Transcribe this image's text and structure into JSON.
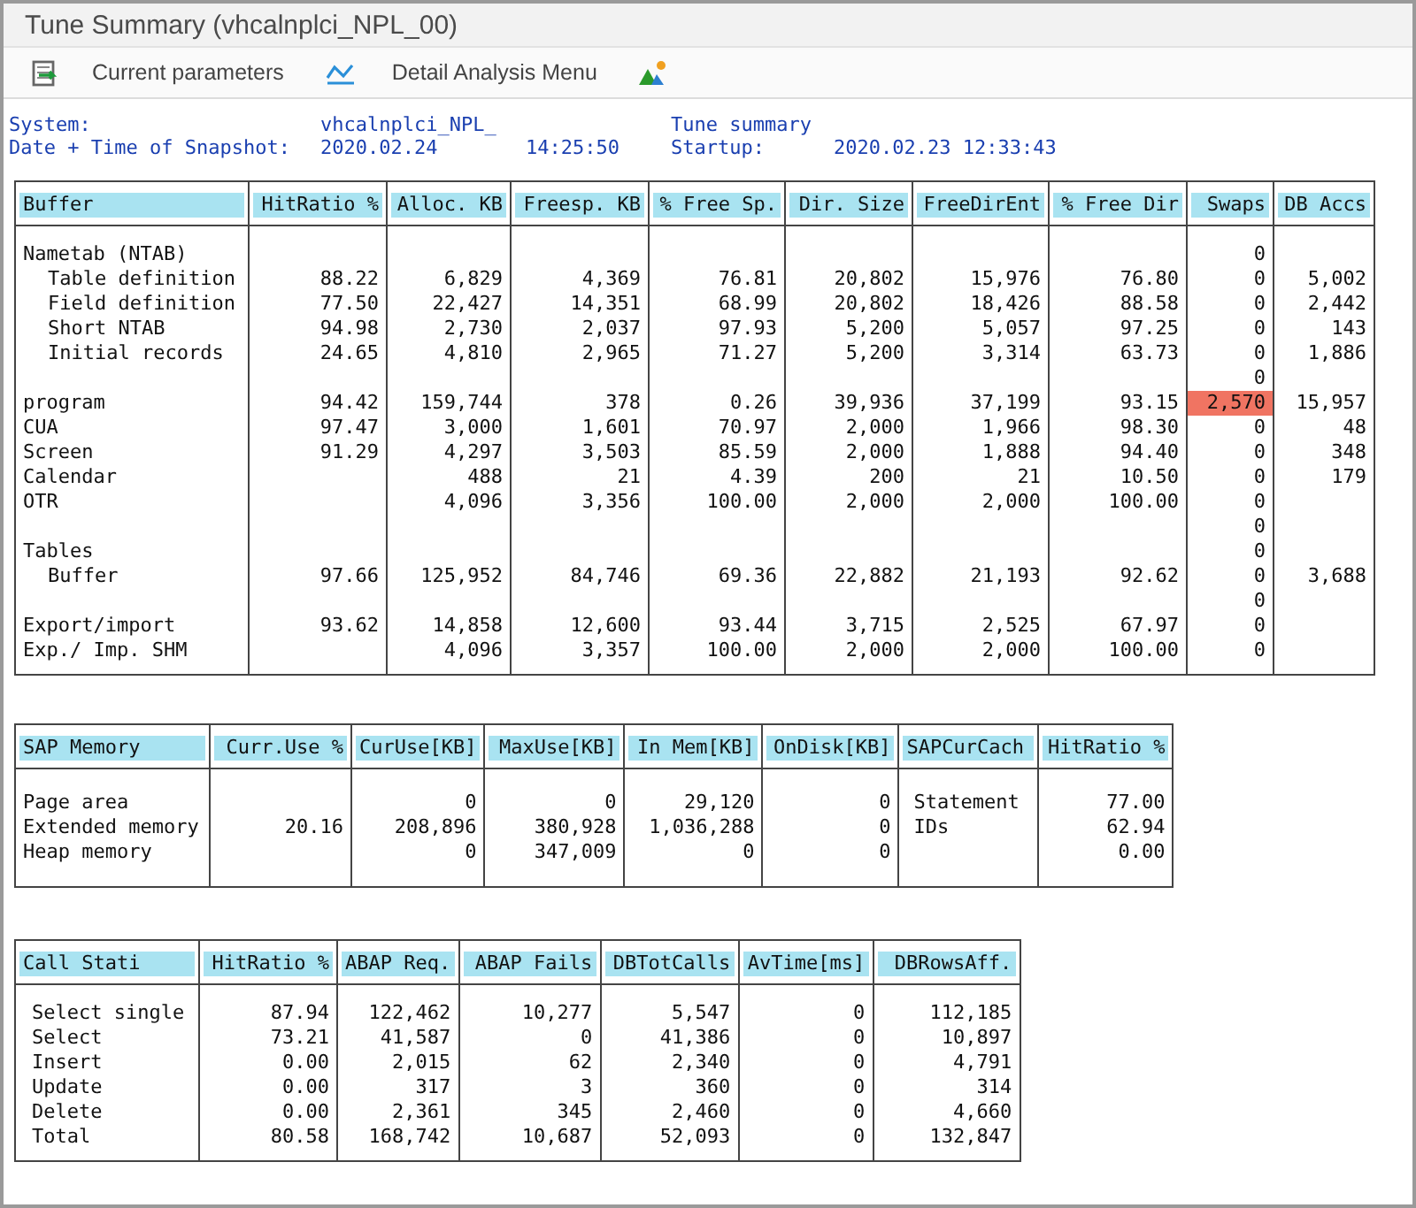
{
  "window": {
    "title": "Tune Summary (vhcalnplci_NPL_00)"
  },
  "toolbar": [
    {
      "kind": "sheet"
    },
    {
      "kind": "text",
      "label": "Current parameters"
    },
    {
      "kind": "chart"
    },
    {
      "kind": "text",
      "label": "Detail Analysis Menu"
    },
    {
      "kind": "mountain"
    }
  ],
  "info": {
    "system_label": "System:",
    "system": "vhcalnplci_NPL_",
    "report": "Tune summary",
    "snapshot_label": "Date + Time of Snapshot:",
    "snapshot_date": "2020.02.24",
    "snapshot_time": "14:25:50",
    "startup_label": "Startup:",
    "startup": "2020.02.23 12:33:43"
  },
  "buffer_table": {
    "columns": [
      {
        "label": "Buffer",
        "kind": "label"
      },
      {
        "label": "HitRatio %",
        "kind": "number"
      },
      {
        "label": "Alloc. KB",
        "kind": "number"
      },
      {
        "label": "Freesp. KB",
        "kind": "number"
      },
      {
        "label": "% Free Sp.",
        "kind": "number"
      },
      {
        "label": "Dir. Size",
        "kind": "number"
      },
      {
        "label": "FreeDirEnt",
        "kind": "number"
      },
      {
        "label": "% Free Dir",
        "kind": "number"
      },
      {
        "label": "Swaps",
        "kind": "counter"
      },
      {
        "label": "DB Accs",
        "kind": "number"
      }
    ],
    "rows": [
      {
        "label": "Nametab (NTAB)",
        "swaps": "0",
        "alert": false,
        "children": [
          {
            "label": "Table definition",
            "hit_ratio": "88.22",
            "alloc_kb": "6,829",
            "freesp_kb": "4,369",
            "free_sp_pct": "76.81",
            "dir_size": "20,802",
            "free_dir_ent": "15,976",
            "free_dir_pct": "76.80",
            "swaps": "0",
            "db_accs": "5,002",
            "alert": false
          },
          {
            "label": "Field definition",
            "hit_ratio": "77.50",
            "alloc_kb": "22,427",
            "freesp_kb": "14,351",
            "free_sp_pct": "68.99",
            "dir_size": "20,802",
            "free_dir_ent": "18,426",
            "free_dir_pct": "88.58",
            "swaps": "0",
            "db_accs": "2,442",
            "alert": false
          },
          {
            "label": "Short NTAB",
            "hit_ratio": "94.98",
            "alloc_kb": "2,730",
            "freesp_kb": "2,037",
            "free_sp_pct": "97.93",
            "dir_size": "5,200",
            "free_dir_ent": "5,057",
            "free_dir_pct": "97.25",
            "swaps": "0",
            "db_accs": "143",
            "alert": false
          },
          {
            "label": "Initial records",
            "hit_ratio": "24.65",
            "alloc_kb": "4,810",
            "freesp_kb": "2,965",
            "free_sp_pct": "71.27",
            "dir_size": "5,200",
            "free_dir_ent": "3,314",
            "free_dir_pct": "63.73",
            "swaps": "0",
            "db_accs": "1,886",
            "alert": false
          }
        ]
      },
      {
        "swaps": "0",
        "alert": false
      },
      {
        "label": "program",
        "hit_ratio": "94.42",
        "alloc_kb": "159,744",
        "freesp_kb": "378",
        "free_sp_pct": "0.26",
        "dir_size": "39,936",
        "free_dir_ent": "37,199",
        "free_dir_pct": "93.15",
        "swaps": "2,570",
        "db_accs": "15,957",
        "alert": true
      },
      {
        "label": "CUA",
        "hit_ratio": "97.47",
        "alloc_kb": "3,000",
        "freesp_kb": "1,601",
        "free_sp_pct": "70.97",
        "dir_size": "2,000",
        "free_dir_ent": "1,966",
        "free_dir_pct": "98.30",
        "swaps": "0",
        "db_accs": "48",
        "alert": false
      },
      {
        "label": "Screen",
        "hit_ratio": "91.29",
        "alloc_kb": "4,297",
        "freesp_kb": "3,503",
        "free_sp_pct": "85.59",
        "dir_size": "2,000",
        "free_dir_ent": "1,888",
        "free_dir_pct": "94.40",
        "swaps": "0",
        "db_accs": "348",
        "alert": false
      },
      {
        "label": "Calendar",
        "alloc_kb": "488",
        "freesp_kb": "21",
        "free_sp_pct": "4.39",
        "dir_size": "200",
        "free_dir_ent": "21",
        "free_dir_pct": "10.50",
        "swaps": "0",
        "db_accs": "179",
        "alert": false
      },
      {
        "label": "OTR",
        "alloc_kb": "4,096",
        "freesp_kb": "3,356",
        "free_sp_pct": "100.00",
        "dir_size": "2,000",
        "free_dir_ent": "2,000",
        "free_dir_pct": "100.00",
        "swaps": "0",
        "alert": false
      },
      {
        "swaps": "0",
        "alert": false
      },
      {
        "label": "Tables",
        "swaps": "0",
        "alert": false,
        "children": [
          {
            "label": "Buffer",
            "hit_ratio": "97.66",
            "alloc_kb": "125,952",
            "freesp_kb": "84,746",
            "free_sp_pct": "69.36",
            "dir_size": "22,882",
            "free_dir_ent": "21,193",
            "free_dir_pct": "92.62",
            "swaps": "0",
            "db_accs": "3,688",
            "alert": false
          }
        ]
      },
      {
        "swaps": "0",
        "alert": false
      },
      {
        "label": "Export/import",
        "hit_ratio": "93.62",
        "alloc_kb": "14,858",
        "freesp_kb": "12,600",
        "free_sp_pct": "93.44",
        "dir_size": "3,715",
        "free_dir_ent": "2,525",
        "free_dir_pct": "67.97",
        "swaps": "0",
        "alert": false
      },
      {
        "label": "Exp./ Imp. SHM",
        "alloc_kb": "4,096",
        "freesp_kb": "3,357",
        "free_sp_pct": "100.00",
        "dir_size": "2,000",
        "free_dir_ent": "2,000",
        "free_dir_pct": "100.00",
        "swaps": "0",
        "alert": false
      }
    ]
  },
  "memory_table": {
    "columns": [
      {
        "label": "SAP Memory",
        "kind": "label"
      },
      {
        "label": "Curr.Use %",
        "kind": "number"
      },
      {
        "label": "CurUse[KB]",
        "kind": "number"
      },
      {
        "label": "MaxUse[KB]",
        "kind": "number"
      },
      {
        "label": "In Mem[KB]",
        "kind": "number"
      },
      {
        "label": "OnDisk[KB]",
        "kind": "number"
      },
      {
        "label": "SAPCurCach",
        "kind": "text"
      },
      {
        "label": "HitRatio %",
        "kind": "number"
      }
    ],
    "rows": [
      {
        "label": "Page area",
        "cur_use_kb": "0",
        "max_use_kb": "0",
        "in_mem_kb": "29,120",
        "on_disk_kb": "0",
        "sap_cur_cach": "Statement",
        "hit_ratio": "77.00"
      },
      {
        "label": "Extended memory",
        "curr_use_pct": "20.16",
        "cur_use_kb": "208,896",
        "max_use_kb": "380,928",
        "in_mem_kb": "1,036,288",
        "on_disk_kb": "0",
        "sap_cur_cach": "IDs",
        "hit_ratio": "62.94"
      },
      {
        "label": "Heap memory",
        "cur_use_kb": "0",
        "max_use_kb": "347,009",
        "in_mem_kb": "0",
        "on_disk_kb": "0",
        "hit_ratio": "0.00"
      }
    ]
  },
  "call_table": {
    "columns": [
      {
        "label": "Call Stati",
        "kind": "label"
      },
      {
        "label": "HitRatio %",
        "kind": "number"
      },
      {
        "label": "ABAP Req.",
        "kind": "number"
      },
      {
        "label": "ABAP Fails",
        "kind": "number"
      },
      {
        "label": "DBTotCalls",
        "kind": "number"
      },
      {
        "label": "AvTime[ms]",
        "kind": "number"
      },
      {
        "label": "DBRowsAff.",
        "kind": "number"
      }
    ],
    "rows": [
      {
        "label": "Select single",
        "hit_ratio": "87.94",
        "abap_req": "122,462",
        "abap_fails": "10,277",
        "db_tot_calls": "5,547",
        "av_time_ms": "0",
        "db_rows_aff": "112,185"
      },
      {
        "label": "Select",
        "hit_ratio": "73.21",
        "abap_req": "41,587",
        "abap_fails": "0",
        "db_tot_calls": "41,386",
        "av_time_ms": "0",
        "db_rows_aff": "10,897"
      },
      {
        "label": "Insert",
        "hit_ratio": "0.00",
        "abap_req": "2,015",
        "abap_fails": "62",
        "db_tot_calls": "2,340",
        "av_time_ms": "0",
        "db_rows_aff": "4,791"
      },
      {
        "label": "Update",
        "hit_ratio": "0.00",
        "abap_req": "317",
        "abap_fails": "3",
        "db_tot_calls": "360",
        "av_time_ms": "0",
        "db_rows_aff": "314"
      },
      {
        "label": "Delete",
        "hit_ratio": "0.00",
        "abap_req": "2,361",
        "abap_fails": "345",
        "db_tot_calls": "2,460",
        "av_time_ms": "0",
        "db_rows_aff": "4,660"
      },
      {
        "label": "Total",
        "hit_ratio": "80.58",
        "abap_req": "168,742",
        "abap_fails": "10,687",
        "db_tot_calls": "52,093",
        "av_time_ms": "0",
        "db_rows_aff": "132,847"
      }
    ]
  }
}
